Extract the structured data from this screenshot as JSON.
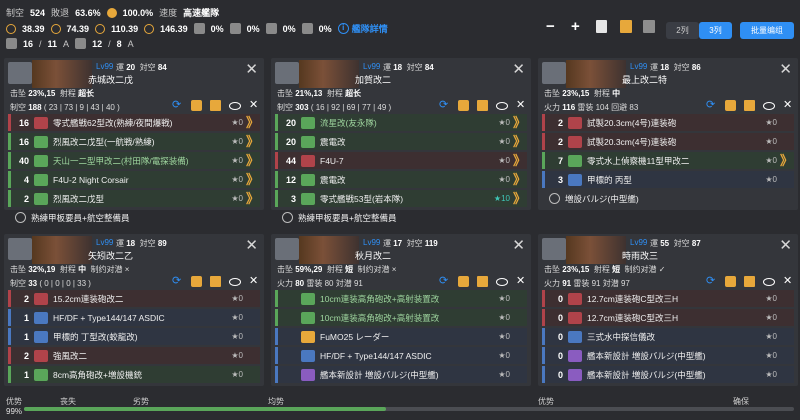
{
  "header": {
    "air_label": "制空",
    "air_value": "524",
    "defeat_label": "敗退",
    "defeat_value": "63.6%",
    "pct100": "100.0%",
    "speed_label": "速度",
    "speed_value": "高速艦隊",
    "fuel_a": "38.39",
    "fuel_b": "74.39",
    "fuel_c": "110.39",
    "fuel_d": "146.39",
    "drum1": "0%",
    "drum2": "0%",
    "drum3": "0%",
    "drum4": "0%",
    "fleet_detail": "艦隊詳情",
    "tp_a": "16",
    "tp_a2": "11",
    "tp_a_unit": "A",
    "tp_b": "12",
    "tp_b2": "8",
    "tp_b_unit": "A",
    "btn_2": "2列",
    "btn_3": "3列",
    "btn_batch": "批量编组"
  },
  "ships": [
    {
      "lv": "Lv99",
      "luck_label": "運",
      "luck": "20",
      "aa_label": "対空",
      "aa": "84",
      "name": "赤城改二戊",
      "evade_label": "击坠",
      "evade": "23%,15",
      "range_label": "射程",
      "range": "超长",
      "line3": "制空",
      "line3_value": "188",
      "line3_detail": "( 23 | 73 | 9 | 43 | 40 )",
      "slots": [
        {
          "n": "16",
          "name": "零式艦戦62型改(熟練/夜間爆戦)",
          "star": "★0",
          "cls": "red",
          "color": "#b0434a",
          "prof": "》"
        },
        {
          "n": "16",
          "name": "烈風改二戊型(一航戦/熟練)",
          "star": "★0",
          "cls": "green",
          "color": "#5aa65a",
          "prof": "》"
        },
        {
          "n": "40",
          "name": "天山一二型甲改二(村田隊/電探装備)",
          "star": "★0",
          "cls": "green",
          "color": "#5aa65a",
          "prof": "》",
          "dim": true
        },
        {
          "n": "4",
          "name": "F4U-2 Night Corsair",
          "star": "★0",
          "cls": "green",
          "color": "#5aa65a",
          "prof": "》"
        },
        {
          "n": "2",
          "name": "烈風改二戊型",
          "star": "★0",
          "cls": "green",
          "color": "#5aa65a",
          "prof": "》"
        }
      ],
      "extra": "熟練甲板要員+航空整備員"
    },
    {
      "lv": "Lv99",
      "luck_label": "運",
      "luck": "18",
      "aa_label": "対空",
      "aa": "84",
      "name": "加賀改二",
      "evade_label": "击坠",
      "evade": "21%,13",
      "range_label": "射程",
      "range": "超长",
      "line3": "制空",
      "line3_value": "303",
      "line3_detail": "( 16 | 92 | 69 | 77 | 49 )",
      "slots": [
        {
          "n": "20",
          "name": "流星改(友永隊)",
          "star": "★0",
          "cls": "green",
          "color": "#5aa65a",
          "prof": "》",
          "dim": true
        },
        {
          "n": "20",
          "name": "震電改",
          "star": "★0",
          "cls": "green",
          "color": "#5aa65a",
          "prof": "》"
        },
        {
          "n": "44",
          "name": "F4U-7",
          "star": "★0",
          "cls": "red",
          "color": "#b0434a",
          "prof": "》"
        },
        {
          "n": "12",
          "name": "震電改",
          "star": "★0",
          "cls": "green",
          "color": "#5aa65a",
          "prof": "》"
        },
        {
          "n": "3",
          "name": "零式艦戦53型(岩本隊)",
          "star": "★10",
          "cls": "green",
          "color": "#5aa65a",
          "prof": "》",
          "teal": true
        }
      ],
      "extra": "熟練甲板要員+航空整備員"
    },
    {
      "lv": "Lv99",
      "luck_label": "運",
      "luck": "18",
      "aa_label": "対空",
      "aa": "86",
      "name": "最上改二特",
      "evade_label": "击坠",
      "evade": "23%,15",
      "range_label": "射程",
      "range": "中",
      "line3": "火力",
      "line3_value": "116",
      "line3_detail": "雷装 104  回避 83",
      "slots": [
        {
          "n": "2",
          "name": "試製20.3cm(4号)連装砲",
          "star": "★0",
          "cls": "red",
          "color": "#b0434a",
          "prof": ""
        },
        {
          "n": "2",
          "name": "試製20.3cm(4号)連装砲",
          "star": "★0",
          "cls": "red",
          "color": "#b0434a",
          "prof": ""
        },
        {
          "n": "7",
          "name": "零式水上偵察機11型甲改二",
          "star": "★0",
          "cls": "green",
          "color": "#5aa65a",
          "prof": "》"
        },
        {
          "n": "3",
          "name": "甲標的 丙型",
          "star": "★0",
          "cls": "blue",
          "color": "#4a78c0",
          "prof": ""
        }
      ],
      "extra": "増設バルジ(中型艦)"
    },
    {
      "lv": "Lv99",
      "luck_label": "運",
      "luck": "18",
      "aa_label": "対空",
      "aa": "89",
      "name": "矢矧改二乙",
      "evade_label": "击坠",
      "evade": "32%,19",
      "range_label": "射程",
      "range": "中",
      "line3b": "制约对潜 ×",
      "line3": "制空",
      "line3_value": "33",
      "line3_detail": "( 0 | 0 | 0 | 33 )",
      "slots": [
        {
          "n": "2",
          "name": "15.2cm連装砲改二",
          "star": "★0",
          "cls": "red",
          "color": "#b0434a",
          "prof": ""
        },
        {
          "n": "1",
          "name": "HF/DF + Type144/147 ASDIC",
          "star": "★0",
          "cls": "blue",
          "color": "#4a78c0",
          "prof": ""
        },
        {
          "n": "1",
          "name": "甲標的 丁型改(蛟龍改)",
          "star": "★0",
          "cls": "blue",
          "color": "#4a78c0",
          "prof": ""
        },
        {
          "n": "2",
          "name": "強風改二",
          "star": "★0",
          "cls": "red",
          "color": "#b0434a",
          "prof": ""
        },
        {
          "n": "1",
          "name": "8cm高角砲改+増設機銃",
          "star": "★0",
          "cls": "green",
          "color": "#5aa65a",
          "prof": ""
        }
      ],
      "extra": ""
    },
    {
      "lv": "Lv99",
      "luck_label": "運",
      "luck": "17",
      "aa_label": "対空",
      "aa": "119",
      "name": "秋月改二",
      "evade_label": "击坠",
      "evade": "59%,29",
      "range_label": "射程",
      "range": "短",
      "line3b": "制约对潜 ×",
      "line3": "火力",
      "line3_value": "80",
      "line3_detail": "雷装 80  対潜 91",
      "slots": [
        {
          "n": "",
          "name": "10cm連装高角砲改+高射装置改",
          "star": "★0",
          "cls": "green",
          "color": "#5aa65a",
          "prof": "",
          "dim": true
        },
        {
          "n": "",
          "name": "10cm連装高角砲改+高射装置改",
          "star": "★0",
          "cls": "green",
          "color": "#5aa65a",
          "prof": "",
          "dim": true
        },
        {
          "n": "",
          "name": "FuMO25 レーダー",
          "star": "★0",
          "cls": "blue",
          "color": "#e7a83b",
          "prof": ""
        },
        {
          "n": "",
          "name": "HF/DF + Type144/147 ASDIC",
          "star": "★0",
          "cls": "blue",
          "color": "#4a78c0",
          "prof": ""
        },
        {
          "n": "",
          "name": "艦本新設計 増設バルジ(中型艦)",
          "star": "★0",
          "cls": "blue",
          "color": "#8a5cc0",
          "prof": ""
        }
      ],
      "extra": ""
    },
    {
      "lv": "Lv99",
      "luck_label": "運",
      "luck": "55",
      "aa_label": "対空",
      "aa": "87",
      "name": "時雨改三",
      "evade_label": "击坠",
      "evade": "23%,15",
      "range_label": "射程",
      "range": "短",
      "line3b": "制约对潜 ✓",
      "line3": "火力",
      "line3_value": "91",
      "line3_detail": "雷装 91  対潜 97",
      "slots": [
        {
          "n": "0",
          "name": "12.7cm連装砲C型改三H",
          "star": "★0",
          "cls": "red",
          "color": "#b0434a",
          "prof": ""
        },
        {
          "n": "0",
          "name": "12.7cm連装砲C型改三H",
          "star": "★0",
          "cls": "red",
          "color": "#b0434a",
          "prof": ""
        },
        {
          "n": "0",
          "name": "三式水中探信儀改",
          "star": "★0",
          "cls": "blue",
          "color": "#4a78c0",
          "prof": ""
        },
        {
          "n": "0",
          "name": "艦本新設計 増設バルジ(中型艦)",
          "star": "★0",
          "cls": "blue",
          "color": "#8a5cc0",
          "prof": ""
        },
        {
          "n": "0",
          "name": "艦本新設計 増設バルジ(中型艦)",
          "star": "★0",
          "cls": "blue",
          "color": "#8a5cc0",
          "prof": ""
        }
      ],
      "extra": ""
    }
  ],
  "air_bar": {
    "left": "优势",
    "pct": "99%",
    "fill": 0.47,
    "labels": [
      "丧失",
      "劣势",
      "均势",
      "优势",
      "确保"
    ]
  }
}
